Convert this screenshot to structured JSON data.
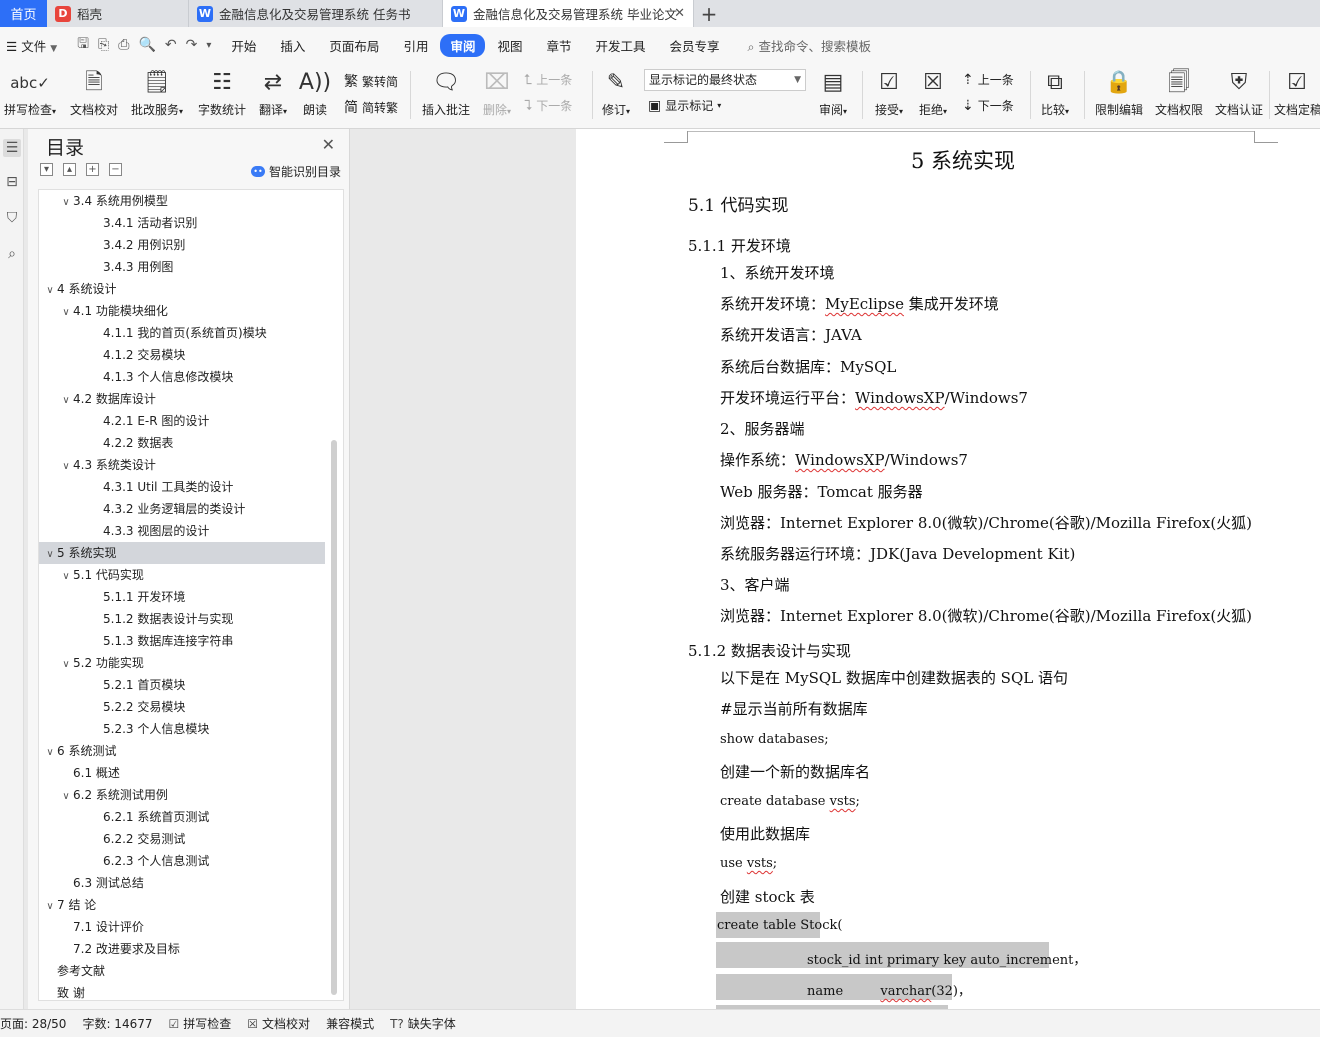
{
  "tabs": {
    "home": "首页",
    "items": [
      {
        "label": "稻壳",
        "icon": "docer-icon",
        "color": "#e8453c"
      },
      {
        "label": "金融信息化及交易管理系统 任务书",
        "icon": "writer-doc-icon",
        "color": "#2d6ff7"
      },
      {
        "label": "金融信息化及交易管理系统 毕业论文",
        "icon": "writer-doc-icon",
        "color": "#2d6ff7"
      }
    ],
    "close_glyph": "✕",
    "add_glyph": "+"
  },
  "menubar": {
    "file": "文件",
    "items": [
      "开始",
      "插入",
      "页面布局",
      "引用",
      "审阅",
      "视图",
      "章节",
      "开发工具",
      "会员专享"
    ],
    "active": "审阅",
    "search": "查找命令、搜索模板"
  },
  "ribbon": {
    "spell_check": "拼写检查",
    "doc_proof": "文档校对",
    "review_service": "批改服务",
    "word_count": "字数统计",
    "translate": "翻译",
    "read_aloud": "朗读",
    "to_traditional": "繁转简",
    "to_simplified": "简转繁",
    "insert_comment": "插入批注",
    "delete": "删除",
    "prev_comment": "上一条",
    "next_comment": "下一条",
    "track_changes": "修订",
    "markup_select": "显示标记的最终状态",
    "show_markup": "显示标记",
    "review": "审阅",
    "accept": "接受",
    "reject": "拒绝",
    "prev_change": "上一条",
    "next_change": "下一条",
    "compare": "比较",
    "restrict_edit": "限制编辑",
    "doc_permission": "文档权限",
    "doc_certify": "文档认证",
    "doc_finalize": "文档定稿"
  },
  "toc": {
    "title": "目录",
    "smart": "智能识别目录",
    "items": [
      {
        "label": "3.4  系统用例模型",
        "level": 2,
        "arrow": true
      },
      {
        "label": "3.4.1  活动者识别",
        "level": 3,
        "arrow": false
      },
      {
        "label": "3.4.2  用例识别",
        "level": 3,
        "arrow": false
      },
      {
        "label": "3.4.3  用例图",
        "level": 3,
        "arrow": false
      },
      {
        "label": "4  系统设计",
        "level": 1,
        "arrow": true
      },
      {
        "label": "4.1  功能模块细化",
        "level": 2,
        "arrow": true
      },
      {
        "label": "4.1.1  我的首页(系统首页)模块",
        "level": 3,
        "arrow": false
      },
      {
        "label": "4.1.2  交易模块",
        "level": 3,
        "arrow": false
      },
      {
        "label": "4.1.3  个人信息修改模块",
        "level": 3,
        "arrow": false
      },
      {
        "label": "4.2  数据库设计",
        "level": 2,
        "arrow": true
      },
      {
        "label": "4.2.1 E-R 图的设计",
        "level": 3,
        "arrow": false
      },
      {
        "label": "4.2.2  数据表",
        "level": 3,
        "arrow": false
      },
      {
        "label": "4.3  系统类设计",
        "level": 2,
        "arrow": true
      },
      {
        "label": "4.3.1 Util 工具类的设计",
        "level": 3,
        "arrow": false
      },
      {
        "label": "4.3.2  业务逻辑层的类设计",
        "level": 3,
        "arrow": false
      },
      {
        "label": "4.3.3  视图层的设计",
        "level": 3,
        "arrow": false
      },
      {
        "label": "5  系统实现",
        "level": 1,
        "arrow": true,
        "selected": true
      },
      {
        "label": "5.1 代码实现",
        "level": 2,
        "arrow": true
      },
      {
        "label": "5.1.1 开发环境",
        "level": 3,
        "arrow": false
      },
      {
        "label": "5.1.2  数据表设计与实现",
        "level": 3,
        "arrow": false
      },
      {
        "label": "5.1.3  数据库连接字符串",
        "level": 3,
        "arrow": false
      },
      {
        "label": "5.2  功能实现",
        "level": 2,
        "arrow": true
      },
      {
        "label": "5.2.1  首页模块",
        "level": 3,
        "arrow": false
      },
      {
        "label": "5.2.2  交易模块",
        "level": 3,
        "arrow": false
      },
      {
        "label": "5.2.3  个人信息模块",
        "level": 3,
        "arrow": false
      },
      {
        "label": "6  系统测试",
        "level": 1,
        "arrow": true
      },
      {
        "label": "6.1  概述",
        "level": 2,
        "arrow": false
      },
      {
        "label": "6.2  系统测试用例",
        "level": 2,
        "arrow": true
      },
      {
        "label": "6.2.1  系统首页测试",
        "level": 3,
        "arrow": false
      },
      {
        "label": "6.2.2  交易测试",
        "level": 3,
        "arrow": false
      },
      {
        "label": "6.2.3  个人信息测试",
        "level": 3,
        "arrow": false
      },
      {
        "label": "6.3  测试总结",
        "level": 2,
        "arrow": false
      },
      {
        "label": "7  结    论",
        "level": 1,
        "arrow": true
      },
      {
        "label": "7.1  设计评价",
        "level": 2,
        "arrow": false
      },
      {
        "label": "7.2  改进要求及目标",
        "level": 2,
        "arrow": false
      },
      {
        "label": "参考文献",
        "level": 1,
        "arrow": false
      },
      {
        "label": "致    谢",
        "level": 1,
        "arrow": false
      }
    ]
  },
  "document": {
    "lines": [
      {
        "text": "5  系统实现",
        "style": "h1"
      },
      {
        "text": "5.1 代码实现",
        "style": "h2"
      },
      {
        "text": "5.1.1 开发环境",
        "style": "h3"
      },
      {
        "text": "1、系统开发环境",
        "style": "p"
      },
      {
        "text": "系统开发环境：MyEclipse 集成开发环境",
        "style": "p"
      },
      {
        "text": "系统开发语言：JAVA",
        "style": "p"
      },
      {
        "text": "系统后台数据库：MySQL",
        "style": "p"
      },
      {
        "text": "开发环境运行平台：WindowsXP/Windows7",
        "style": "p"
      },
      {
        "text": "2、服务器端",
        "style": "p"
      },
      {
        "text": "操作系统：WindowsXP/Windows7",
        "style": "p"
      },
      {
        "text": "Web 服务器：Tomcat 服务器",
        "style": "p"
      },
      {
        "text": "浏览器：Internet Explorer 8.0(微软)/Chrome(谷歌)/Mozilla Firefox(火狐)",
        "style": "p"
      },
      {
        "text": "系统服务器运行环境：JDK(Java Development Kit)",
        "style": "p"
      },
      {
        "text": "3、客户端",
        "style": "p"
      },
      {
        "text": "浏览器：Internet Explorer 8.0(微软)/Chrome(谷歌)/Mozilla Firefox(火狐)",
        "style": "p"
      },
      {
        "text": "5.1.2  数据表设计与实现",
        "style": "h3"
      },
      {
        "text": "以下是在 MySQL 数据库中创建数据表的 SQL 语句",
        "style": "p"
      },
      {
        "text": "#显示当前所有数据库",
        "style": "p"
      },
      {
        "text": "show databases;",
        "style": "code"
      },
      {
        "text": "创建一个新的数据库名",
        "style": "p"
      },
      {
        "text": "create database vsts;",
        "style": "code"
      },
      {
        "text": "使用此数据库",
        "style": "p"
      },
      {
        "text": "use vsts;",
        "style": "code"
      },
      {
        "text": "创建 stock 表",
        "style": "p"
      },
      {
        "text": "create table Stock(",
        "style": "code"
      },
      {
        "text": "stock_id int primary key auto_increment，",
        "style": "code"
      },
      {
        "text": "name          varchar(32)，",
        "style": "code"
      }
    ]
  },
  "statusbar": {
    "page": "页面: 28/50",
    "words": "字数: 14677",
    "spell": "拼写检查",
    "proof": "文档校对",
    "compat": "兼容模式",
    "missing_font": "缺失字体"
  }
}
